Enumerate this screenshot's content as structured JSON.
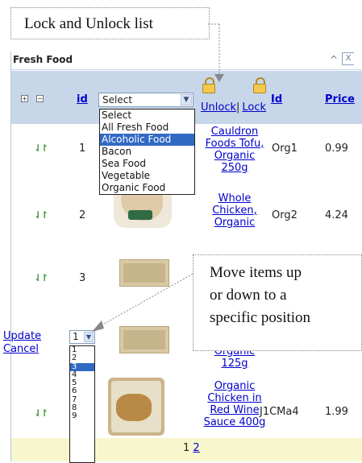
{
  "annotations": {
    "lock_callout": "Lock and Unlock list",
    "move_callout_lines": [
      "Move items up",
      "or down to a",
      "specific position"
    ]
  },
  "panel": {
    "title": "Fresh Food",
    "collapse_icon": "chevron-up-icon",
    "close_icon": "close-icon"
  },
  "header": {
    "id_label": "id",
    "filter_value": "Select",
    "unlock_label": "Unlock",
    "separator": "|",
    "lock_label": "Lock",
    "code_label": "Id",
    "price_label": "Price"
  },
  "filter_options": [
    "Select",
    "All Fresh Food",
    "Alcoholic Food",
    "Bacon",
    "Sea Food",
    "Vegetable",
    "Organic Food"
  ],
  "filter_highlighted": "Alcoholic Food",
  "rows": [
    {
      "id": "1",
      "name_lines": [
        "Cauldron",
        "Foods Tofu,",
        "Organic",
        "250g"
      ],
      "code": "Org1",
      "price": "0.99"
    },
    {
      "id": "2",
      "name_lines": [
        "Whole",
        "Chicken,",
        "Organic"
      ],
      "code": "Org2",
      "price": "4.24"
    },
    {
      "id": "3",
      "name_lines": [],
      "code": "",
      "price": ""
    },
    {
      "id": "",
      "name_lines": [
        "Organic",
        "125g"
      ],
      "code": "",
      "price": ""
    },
    {
      "id": "",
      "name_lines": [
        "Organic",
        "Chicken in",
        "Red Wine",
        "Sauce 400g"
      ],
      "code": "J1CMa4",
      "price": "1.99"
    }
  ],
  "edit": {
    "update_label": "Update",
    "cancel_label": "Cancel",
    "position_value": "1",
    "position_options": [
      "1",
      "2",
      "3",
      "4",
      "5",
      "6",
      "7",
      "8",
      "9"
    ],
    "position_highlighted": "3"
  },
  "pager": {
    "current": "1",
    "next": "2"
  },
  "colors": {
    "header_bg": "#c8d6ea",
    "pager_bg": "#f8f6cd",
    "link": "#0000cc",
    "highlight": "#316ac5"
  }
}
